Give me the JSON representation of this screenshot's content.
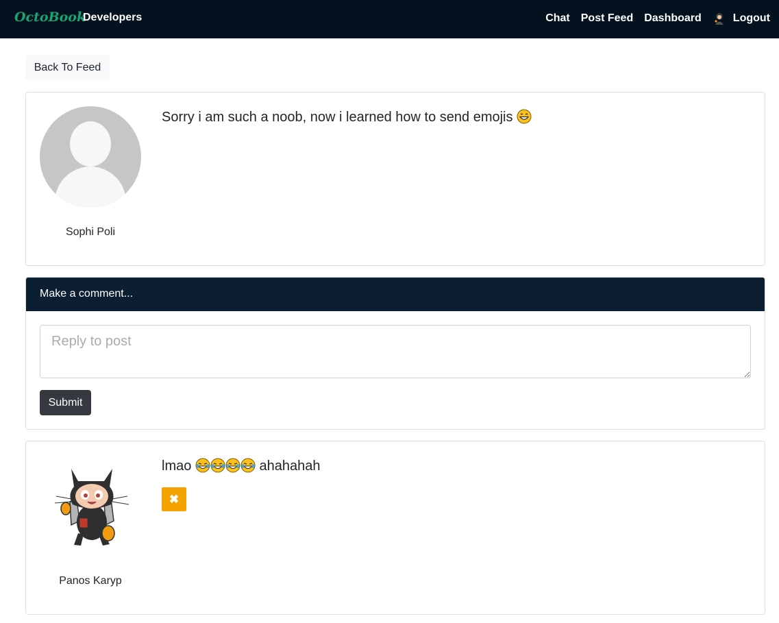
{
  "nav": {
    "brand": "OctoBook",
    "developers": "Developers",
    "chat": "Chat",
    "post_feed": "Post Feed",
    "dashboard": "Dashboard",
    "logout": "Logout"
  },
  "back_button": "Back To Feed",
  "post": {
    "text": "Sorry i am such a noob, now i learned how to send emojis",
    "emoji": "grinning-face-icon",
    "author": "Sophi Poli"
  },
  "comment_form": {
    "header": "Make a comment...",
    "placeholder": "Reply to post",
    "submit": "Submit"
  },
  "comments": [
    {
      "text_before": "lmao",
      "emoji_count": 4,
      "emoji": "tears-of-joy-icon",
      "text_after": "ahahahah",
      "author": "Panos Karyp",
      "delete_icon": "times-icon"
    }
  ],
  "colors": {
    "navbar": "#04111f",
    "brand": "#17a673",
    "form_header": "#0c1e31",
    "submit": "#343a40",
    "delete": "#f5a300"
  }
}
